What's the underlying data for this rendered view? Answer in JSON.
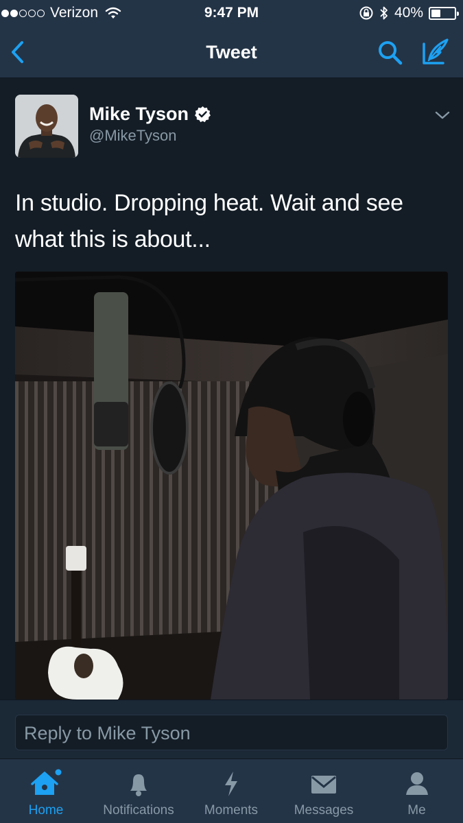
{
  "status_bar": {
    "carrier": "Verizon",
    "time": "9:47 PM",
    "battery": "40%",
    "battery_level": 0.4
  },
  "nav": {
    "title": "Tweet"
  },
  "tweet": {
    "author_name": "Mike Tyson",
    "author_handle": "@MikeTyson",
    "text": "In studio.  Dropping heat. Wait and see what this is about..."
  },
  "reply": {
    "placeholder": "Reply to Mike Tyson"
  },
  "tabs": [
    {
      "label": "Home",
      "icon": "home-icon",
      "active": true,
      "badge": true
    },
    {
      "label": "Notifications",
      "icon": "bell-icon",
      "active": false
    },
    {
      "label": "Moments",
      "icon": "lightning-icon",
      "active": false
    },
    {
      "label": "Messages",
      "icon": "envelope-icon",
      "active": false
    },
    {
      "label": "Me",
      "icon": "person-icon",
      "active": false
    }
  ],
  "colors": {
    "accent": "#1da1f2",
    "background": "#141d26",
    "bar": "#243447",
    "muted": "#8899a6"
  }
}
